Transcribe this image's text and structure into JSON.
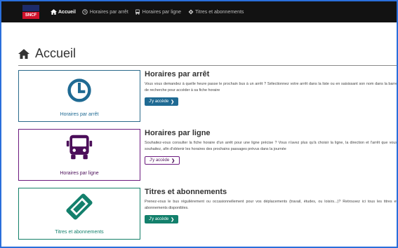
{
  "nav": {
    "brand_text": "SNCF",
    "items": [
      {
        "label": "Accueil",
        "icon": "home-icon",
        "active": true
      },
      {
        "label": "Horaires par arrêt",
        "icon": "clock-icon"
      },
      {
        "label": "Horaires par ligne",
        "icon": "bus-icon"
      },
      {
        "label": "Titres et abonnements",
        "icon": "ticket-icon"
      }
    ]
  },
  "page": {
    "title": "Accueil",
    "title_icon": "home-icon"
  },
  "cards": [
    {
      "tile_label": "Horaires par arrêt",
      "icon": "clock-icon",
      "heading": "Horaires par arrêt",
      "text": "Vous vous demandez à quelle heure passe le prochain bus à un arrêt ? Sélectionnez votre arrêt dans la liste ou en saisissant son nom dans la barre de recherche pour accéder à sa fiche horaire",
      "button": "J'y accède",
      "color": "#1f6a93"
    },
    {
      "tile_label": "Horaires par ligne",
      "icon": "bus-icon",
      "heading": "Horaires par ligne",
      "text": "Souhaitez-vous consulter la fiche horaire d'un arrêt pour une ligne précise ? Vous n'avez plus qu'à choisir la ligne, la direction et l'arrêt que vous souhaitez, afin d'obtenir les horaires des prochains passages prévus dans la journée",
      "button": "J'y accède",
      "color": "#4b0e59"
    },
    {
      "tile_label": "Titres et abonnements",
      "icon": "ticket-icon",
      "heading": "Titres et abonnements",
      "text": "Prenez-vous le bus régulièrement ou occasionnellement pour vos déplacements (travail, études, ou loisirs...)? Retrouvez ici tous les titres et abonnements disponibles.",
      "button": "J'y accède",
      "color": "#13806c"
    }
  ]
}
